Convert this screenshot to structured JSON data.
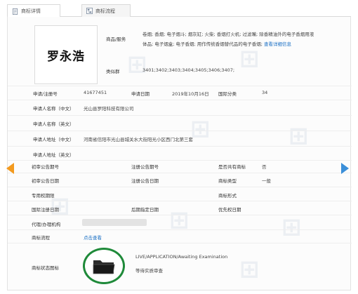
{
  "tabs": [
    {
      "label": "商标详情",
      "active": true
    },
    {
      "label": "商标流程",
      "active": false
    }
  ],
  "trademark": {
    "logo_text": "罗永浩"
  },
  "goods": {
    "label": "商品/服务",
    "line1": "卷烟; 香烟; 电子烟斗; 烟灰缸; 火柴; 香烟打火机; 过滤嘴; 除香精油外的电子香烟用液",
    "line2": "体品; 电子烟盒; 电子香烟; 用作传统香烟替代品的电子香烟;",
    "more_link": "查看详细信息"
  },
  "similar_group": {
    "label": "类似群",
    "value": "3401;3402;3403;3404;3405;3406;3407;"
  },
  "fields": {
    "reg_no_label": "申请/注册号",
    "reg_no": "41677451",
    "apply_date_label": "申请日期",
    "apply_date": "2019年10月16日",
    "intl_class_label": "国际分类",
    "intl_class": "34",
    "applicant_cn_label": "申请人名称（中文）",
    "applicant_cn": "光山县罗阳科技有限公司",
    "applicant_en_label": "申请人名称（英文）",
    "address_cn_label": "申请人地址（中文）",
    "address_cn": "河南省信阳市光山县城关水大街阳光小区西门北第三套",
    "address_en_label": "申请人地址（英文）",
    "prelim_pub_no_label": "初审公告期号",
    "reg_pub_no_label": "注册公告期号",
    "shared_label": "是否共有商标",
    "shared": "否",
    "prelim_pub_date_label": "初审公告日期",
    "reg_pub_date_label": "注册公告日期",
    "tm_type_label": "商标类型",
    "tm_type": "一般",
    "exclusive_period_label": "专用权期限",
    "tm_form_label": "商标形式",
    "intl_reg_date_label": "国际注册日期",
    "later_designation_label": "后期指定日期",
    "priority_date_label": "优先权日期",
    "agent_label": "代理/办理机构",
    "process_label": "商标流程",
    "process_link": "点击查看",
    "status_icon_label": "商标状态图标",
    "status_en": "LIVE/APPLICATION/Awaiting Examination",
    "status_cn": "等待实质审查"
  },
  "colors": {
    "arrow_left": "#f39a1f",
    "arrow_right": "#3b8fd9",
    "status_ring": "#1f8a3a",
    "link": "#1a6fc4"
  },
  "icons": {
    "tab_detail": "document-icon",
    "tab_process": "flowchart-icon",
    "status": "folder-icon",
    "prev": "arrow-left-icon",
    "next": "arrow-right-icon"
  }
}
